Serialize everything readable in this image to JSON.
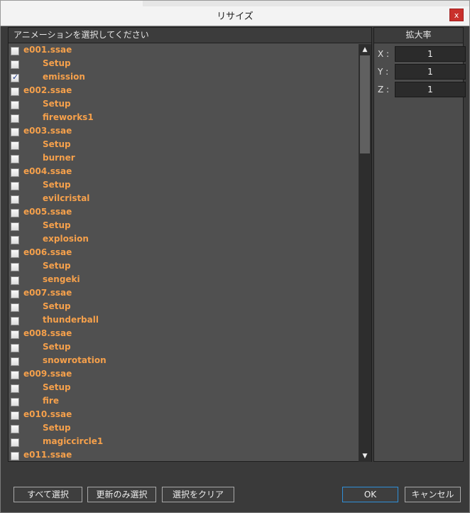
{
  "window": {
    "title": "リサイズ",
    "close_glyph": "x"
  },
  "list_panel": {
    "header": "アニメーションを選択してください",
    "items": [
      {
        "label": "e001.ssae",
        "type": "file",
        "checked": false
      },
      {
        "label": "Setup",
        "type": "anim",
        "checked": false
      },
      {
        "label": "emission",
        "type": "anim",
        "checked": true
      },
      {
        "label": "e002.ssae",
        "type": "file",
        "checked": false
      },
      {
        "label": "Setup",
        "type": "anim",
        "checked": false
      },
      {
        "label": "fireworks1",
        "type": "anim",
        "checked": false
      },
      {
        "label": "e003.ssae",
        "type": "file",
        "checked": false
      },
      {
        "label": "Setup",
        "type": "anim",
        "checked": false
      },
      {
        "label": "burner",
        "type": "anim",
        "checked": false
      },
      {
        "label": "e004.ssae",
        "type": "file",
        "checked": false
      },
      {
        "label": "Setup",
        "type": "anim",
        "checked": false
      },
      {
        "label": "evilcristal",
        "type": "anim",
        "checked": false
      },
      {
        "label": "e005.ssae",
        "type": "file",
        "checked": false
      },
      {
        "label": "Setup",
        "type": "anim",
        "checked": false
      },
      {
        "label": "explosion",
        "type": "anim",
        "checked": false
      },
      {
        "label": "e006.ssae",
        "type": "file",
        "checked": false
      },
      {
        "label": "Setup",
        "type": "anim",
        "checked": false
      },
      {
        "label": "sengeki",
        "type": "anim",
        "checked": false
      },
      {
        "label": "e007.ssae",
        "type": "file",
        "checked": false
      },
      {
        "label": "Setup",
        "type": "anim",
        "checked": false
      },
      {
        "label": "thunderball",
        "type": "anim",
        "checked": false
      },
      {
        "label": "e008.ssae",
        "type": "file",
        "checked": false
      },
      {
        "label": "Setup",
        "type": "anim",
        "checked": false
      },
      {
        "label": "snowrotation",
        "type": "anim",
        "checked": false
      },
      {
        "label": "e009.ssae",
        "type": "file",
        "checked": false
      },
      {
        "label": "Setup",
        "type": "anim",
        "checked": false
      },
      {
        "label": "fire",
        "type": "anim",
        "checked": false
      },
      {
        "label": "e010.ssae",
        "type": "file",
        "checked": false
      },
      {
        "label": "Setup",
        "type": "anim",
        "checked": false
      },
      {
        "label": "magiccircle1",
        "type": "anim",
        "checked": false
      },
      {
        "label": "e011.ssae",
        "type": "file",
        "checked": false
      }
    ],
    "scrollbar": {
      "up_glyph": "▲",
      "down_glyph": "▼"
    }
  },
  "scale_panel": {
    "header": "拡大率",
    "fields": [
      {
        "label": "X :",
        "value": "1"
      },
      {
        "label": "Y :",
        "value": "1"
      },
      {
        "label": "Z :",
        "value": "1"
      }
    ]
  },
  "footer": {
    "select_all": "すべて選択",
    "select_updated": "更新のみ選択",
    "clear_selection": "選択をクリア",
    "ok": "OK",
    "cancel": "キャンセル"
  },
  "colors": {
    "item_text": "#f5a04b",
    "panel_bg": "#505050",
    "dialog_bg": "#3a3a3a",
    "ok_border": "#2f8fd8",
    "close_bg": "#c9302c"
  }
}
